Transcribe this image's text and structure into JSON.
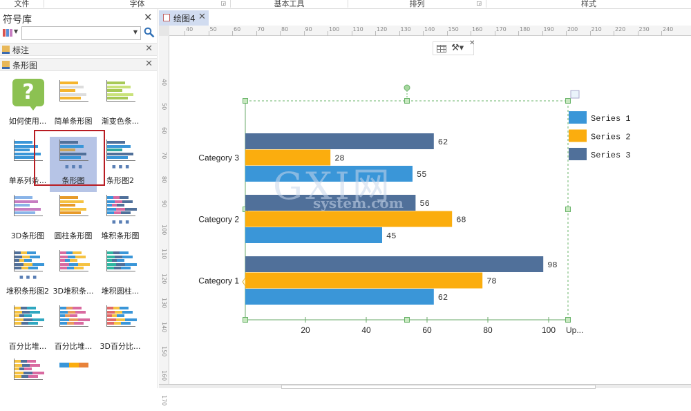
{
  "ribbon": {
    "groups": [
      {
        "label": "文件",
        "launcher": false
      },
      {
        "label": "字体",
        "launcher": true
      },
      {
        "label": "基本工具",
        "launcher": false
      },
      {
        "label": "排列",
        "launcher": true
      },
      {
        "label": "样式",
        "launcher": false
      }
    ]
  },
  "sidebar": {
    "title": "符号库",
    "search": {
      "value": "",
      "placeholder": ""
    },
    "categories": [
      {
        "label": "标注"
      },
      {
        "label": "条形图"
      }
    ],
    "shapes": [
      {
        "label": "如何使用...",
        "icon": "help-bubble-icon"
      },
      {
        "label": "简单条形图",
        "icon": "simple-bar-chart-icon"
      },
      {
        "label": "渐变色条...",
        "icon": "gradient-bar-chart-icon"
      },
      {
        "label": "单系列条...",
        "icon": "single-series-bar-chart-icon"
      },
      {
        "label": "条形图",
        "icon": "bar-chart-icon",
        "selected": true
      },
      {
        "label": "条形图2",
        "icon": "bar-chart-2-icon"
      },
      {
        "label": "3D条形图",
        "icon": "3d-bar-chart-icon"
      },
      {
        "label": "圆柱条形图",
        "icon": "cylinder-bar-chart-icon"
      },
      {
        "label": "堆积条形图",
        "icon": "stacked-bar-chart-icon"
      },
      {
        "label": "堆积条形图2",
        "icon": "stacked-bar-chart-2-icon"
      },
      {
        "label": "3D堆积条...",
        "icon": "3d-stacked-bar-chart-icon"
      },
      {
        "label": "堆积圆柱...",
        "icon": "stacked-cylinder-bar-chart-icon"
      },
      {
        "label": "百分比堆...",
        "icon": "percent-stacked-bar-chart-icon"
      },
      {
        "label": "百分比堆...",
        "icon": "percent-stacked-bar-chart-2-icon"
      },
      {
        "label": "3D百分比...",
        "icon": "3d-percent-bar-chart-icon"
      },
      {
        "label": "",
        "icon": "percent-stacked-bar-chart-3-icon"
      },
      {
        "label": "",
        "icon": "segmented-bar-icon"
      }
    ]
  },
  "document": {
    "tab_label": "绘图4",
    "hruler_labels": [
      "40",
      "50",
      "60",
      "70",
      "80",
      "90",
      "100",
      "110",
      "120",
      "130",
      "140",
      "150",
      "160",
      "170",
      "180",
      "190",
      "200",
      "210",
      "220",
      "230",
      "240"
    ],
    "vruler_labels": [
      "40",
      "50",
      "60",
      "70",
      "80",
      "90",
      "100",
      "110",
      "120",
      "130",
      "140",
      "150",
      "160",
      "170"
    ]
  },
  "watermark": {
    "big": "GXI网",
    "small": "system.com"
  },
  "colors": {
    "series1": "#3a96d8",
    "series2": "#fbad0e",
    "series3": "#50709a",
    "selection": "#6ab46a"
  },
  "chart_data": {
    "type": "bar",
    "orientation": "horizontal",
    "categories": [
      "Category 1",
      "Category 2",
      "Category 3"
    ],
    "series": [
      {
        "name": "Series 1",
        "values": [
          62,
          45,
          55
        ]
      },
      {
        "name": "Series 2",
        "values": [
          78,
          68,
          28
        ]
      },
      {
        "name": "Series 3",
        "values": [
          98,
          56,
          62
        ]
      }
    ],
    "x_ticks": [
      20,
      40,
      60,
      80,
      100
    ],
    "xlim": [
      0,
      105
    ],
    "xlabel": "Up...",
    "legend": "right",
    "grid": false
  }
}
